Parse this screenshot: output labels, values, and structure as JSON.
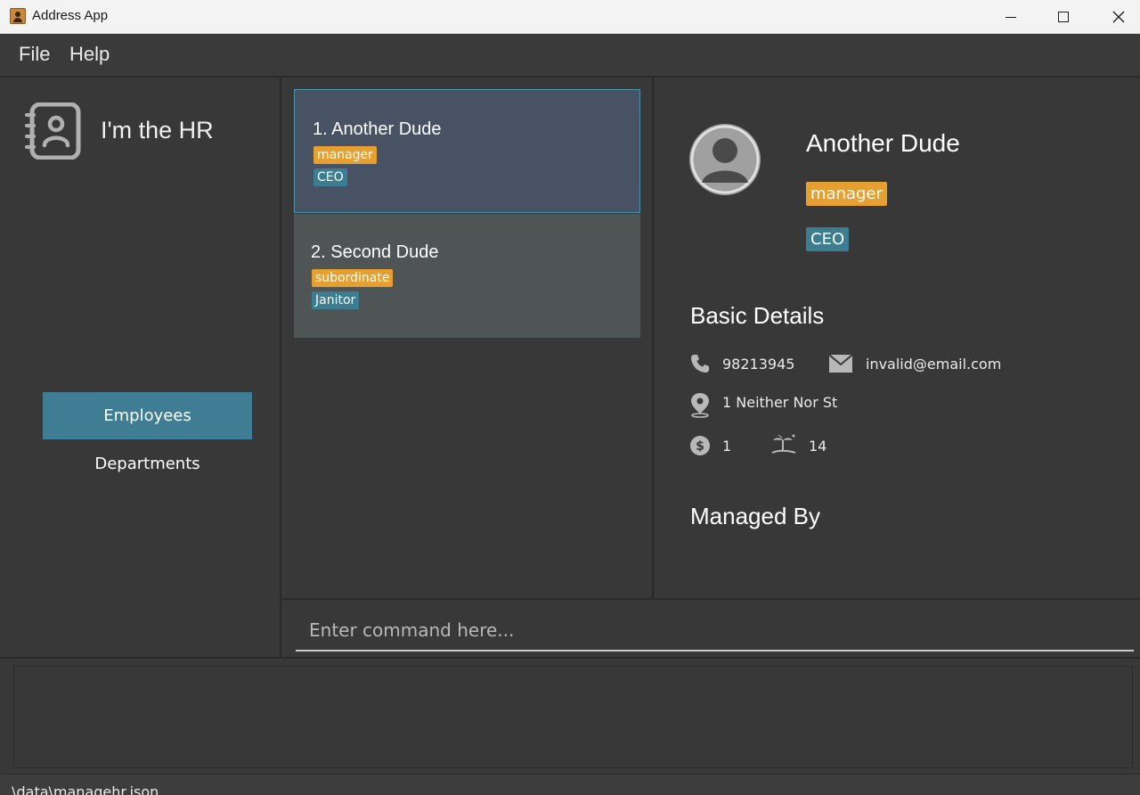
{
  "window": {
    "title": "Address App"
  },
  "menu": {
    "file": "File",
    "help": "Help"
  },
  "sidebar": {
    "brand": "I'm the HR",
    "nav": [
      {
        "label": "Employees",
        "selected": true
      },
      {
        "label": "Departments",
        "selected": false
      }
    ]
  },
  "employees": [
    {
      "index_name": "1.  Another Dude",
      "tags": [
        "manager",
        "CEO"
      ],
      "selected": true
    },
    {
      "index_name": "2.  Second Dude",
      "tags": [
        "subordinate",
        "Janitor"
      ],
      "selected": false
    }
  ],
  "detail": {
    "name": "Another Dude",
    "role_tag": "manager",
    "title_tag": "CEO",
    "basic_details_heading": "Basic Details",
    "phone": "98213945",
    "email": "invalid@email.com",
    "address": "1 Neither Nor St",
    "salary": "1",
    "leave": "14",
    "managed_by_heading": "Managed By"
  },
  "command": {
    "placeholder": "Enter command here..."
  },
  "status": {
    "path": ".\\data\\managehr.json"
  },
  "colors": {
    "accent_blue": "#3e7d93",
    "tag_orange": "#e5a030",
    "tag_blue": "#3c7d92",
    "selected_card": "#475264",
    "background": "#383838"
  }
}
